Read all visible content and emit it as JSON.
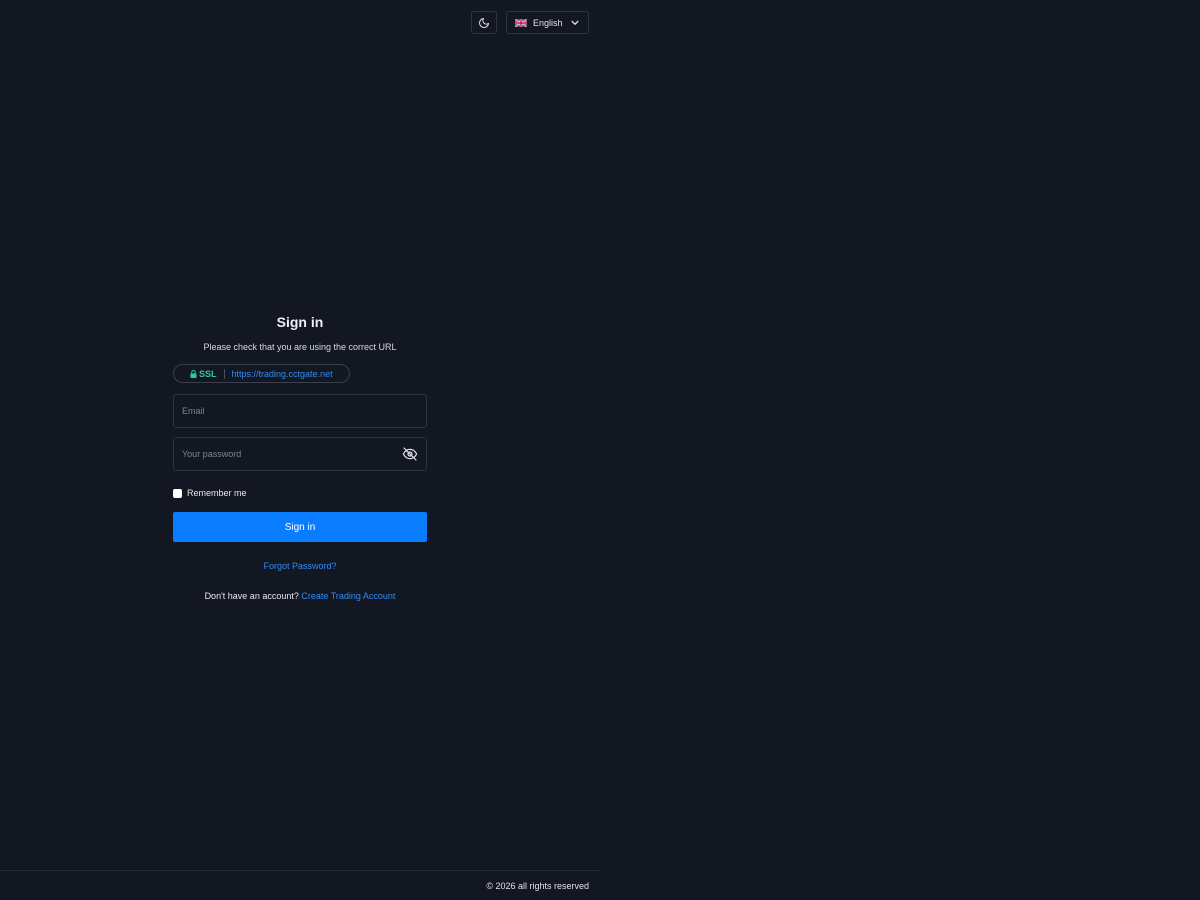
{
  "header": {
    "theme_icon": "moon-icon",
    "language": {
      "label": "English",
      "flag_icon": "uk-flag-icon",
      "chevron_icon": "chevron-down-icon"
    }
  },
  "signin": {
    "title": "Sign in",
    "subtitle": "Please check that you are using the correct URL",
    "ssl": {
      "label": "SSL",
      "url": "https://trading.cctgate.net",
      "icon": "lock-icon"
    },
    "email": {
      "placeholder": "Email",
      "value": ""
    },
    "password": {
      "placeholder": "Your password",
      "value": "",
      "toggle_icon": "eye-off-icon"
    },
    "remember_label": "Remember me",
    "remember_checked": false,
    "submit_label": "Sign in",
    "forgot_label": "Forgot Password?",
    "signup_text": "Don't have an account?",
    "signup_link": "Create Trading Account"
  },
  "footer": {
    "copyright": "© 2026 all rights reserved"
  },
  "colors": {
    "background": "#131722",
    "accent": "#0a7cff",
    "link": "#2f8cf2",
    "ssl_green": "#2ec7a6",
    "border": "#2e3340"
  }
}
